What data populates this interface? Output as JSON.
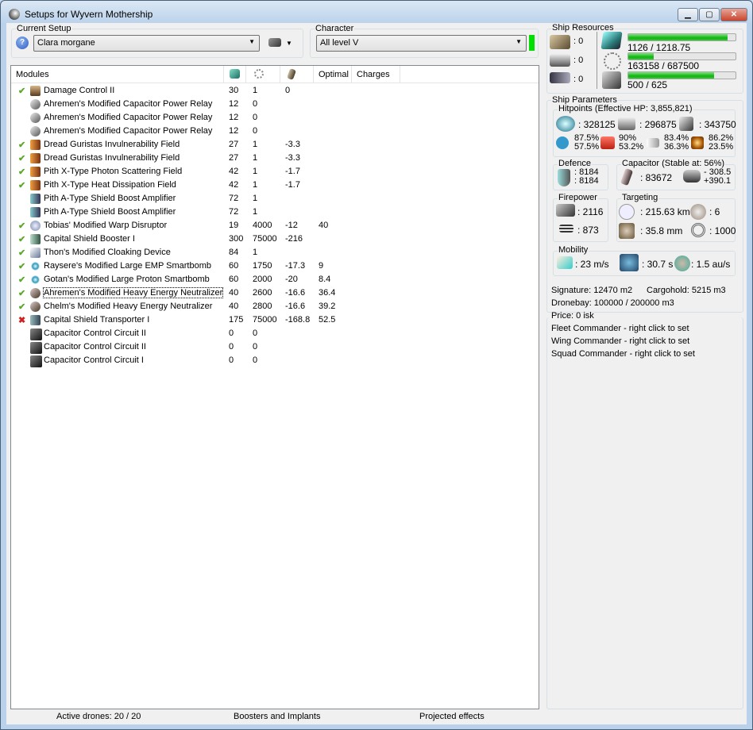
{
  "window": {
    "title": "Setups for Wyvern Mothership"
  },
  "setup": {
    "label": "Current Setup",
    "value": "Clara morgane"
  },
  "character": {
    "label": "Character",
    "value": "All level V",
    "status_color": "#00e000"
  },
  "modules": {
    "headers": [
      "Modules",
      "cpu-icon",
      "powergrid-icon",
      "capacitor-icon",
      "Optimal",
      "Charges"
    ],
    "rows": [
      {
        "state": "on",
        "icon": "damage-control",
        "name": "Damage Control II",
        "c1": "30",
        "c2": "1",
        "c3": "0",
        "c4": ""
      },
      {
        "state": "",
        "icon": "power-relay",
        "name": "Ahremen's Modified Capacitor Power Relay",
        "c1": "12",
        "c2": "0",
        "c3": "",
        "c4": ""
      },
      {
        "state": "",
        "icon": "power-relay",
        "name": "Ahremen's Modified Capacitor Power Relay",
        "c1": "12",
        "c2": "0",
        "c3": "",
        "c4": ""
      },
      {
        "state": "",
        "icon": "power-relay",
        "name": "Ahremen's Modified Capacitor Power Relay",
        "c1": "12",
        "c2": "0",
        "c3": "",
        "c4": ""
      },
      {
        "state": "on",
        "icon": "shield-hardener",
        "name": "Dread Guristas Invulnerability Field",
        "c1": "27",
        "c2": "1",
        "c3": "-3.3",
        "c4": ""
      },
      {
        "state": "on",
        "icon": "shield-hardener",
        "name": "Dread Guristas Invulnerability Field",
        "c1": "27",
        "c2": "1",
        "c3": "-3.3",
        "c4": ""
      },
      {
        "state": "on",
        "icon": "shield-hardener",
        "name": "Pith X-Type Photon Scattering Field",
        "c1": "42",
        "c2": "1",
        "c3": "-1.7",
        "c4": ""
      },
      {
        "state": "on",
        "icon": "shield-hardener",
        "name": "Pith X-Type Heat Dissipation Field",
        "c1": "42",
        "c2": "1",
        "c3": "-1.7",
        "c4": ""
      },
      {
        "state": "",
        "icon": "shield-amp",
        "name": "Pith A-Type Shield Boost Amplifier",
        "c1": "72",
        "c2": "1",
        "c3": "",
        "c4": ""
      },
      {
        "state": "",
        "icon": "shield-amp",
        "name": "Pith A-Type Shield Boost Amplifier",
        "c1": "72",
        "c2": "1",
        "c3": "",
        "c4": ""
      },
      {
        "state": "on",
        "icon": "warp-disruptor",
        "name": "Tobias' Modified Warp Disruptor",
        "c1": "19",
        "c2": "4000",
        "c3": "-12",
        "c4": "40"
      },
      {
        "state": "on",
        "icon": "shield-booster",
        "name": "Capital Shield Booster I",
        "c1": "300",
        "c2": "75000",
        "c3": "-216",
        "c4": ""
      },
      {
        "state": "on",
        "icon": "cloak",
        "name": "Thon's Modified Cloaking Device",
        "c1": "84",
        "c2": "1",
        "c3": "",
        "c4": ""
      },
      {
        "state": "on",
        "icon": "smartbomb",
        "name": "Raysere's Modified Large EMP Smartbomb",
        "c1": "60",
        "c2": "1750",
        "c3": "-17.3",
        "c4": "9"
      },
      {
        "state": "on",
        "icon": "smartbomb",
        "name": "Gotan's Modified Large Proton Smartbomb",
        "c1": "60",
        "c2": "2000",
        "c3": "-20",
        "c4": "8.4"
      },
      {
        "state": "on",
        "icon": "neutralizer",
        "name": "Ahremen's Modified Heavy Energy Neutralizer",
        "c1": "40",
        "c2": "2600",
        "c3": "-16.6",
        "c4": "36.4",
        "focused": true
      },
      {
        "state": "on",
        "icon": "neutralizer",
        "name": "Chelm's Modified Heavy Energy Neutralizer",
        "c1": "40",
        "c2": "2800",
        "c3": "-16.6",
        "c4": "39.2"
      },
      {
        "state": "off",
        "icon": "shield-transporter",
        "name": "Capital Shield Transporter I",
        "c1": "175",
        "c2": "75000",
        "c3": "-168.8",
        "c4": "52.5"
      },
      {
        "state": "",
        "icon": "rig",
        "name": "Capacitor Control Circuit II",
        "c1": "0",
        "c2": "0",
        "c3": "",
        "c4": ""
      },
      {
        "state": "",
        "icon": "rig",
        "name": "Capacitor Control Circuit II",
        "c1": "0",
        "c2": "0",
        "c3": "",
        "c4": ""
      },
      {
        "state": "",
        "icon": "rig",
        "name": "Capacitor Control Circuit I",
        "c1": "0",
        "c2": "0",
        "c3": "",
        "c4": ""
      }
    ]
  },
  "status": {
    "drones": "Active drones: 20 / 20",
    "boosters": "Boosters and Implants",
    "projected": "Projected effects"
  },
  "resources": {
    "label": "Ship Resources",
    "turrets": ": 0",
    "launchers": ": 0",
    "rigs": ": 0",
    "cpu": {
      "text": "1126 / 1218.75",
      "fraction": 0.924
    },
    "power": {
      "text": "163158 / 687500",
      "fraction": 0.237
    },
    "calibration": {
      "text": "500 / 625",
      "fraction": 0.8
    }
  },
  "params": {
    "label": "Ship Parameters",
    "hp_label": "Hitpoints (Effective HP: 3,855,821)",
    "shield": ": 328125",
    "armor": ": 296875",
    "hull": ": 343750",
    "res": [
      [
        "87.5%",
        "57.5%"
      ],
      [
        "90%",
        "53.2%"
      ],
      [
        "83.4%",
        "36.3%"
      ],
      [
        "86.2%",
        "23.5%"
      ]
    ],
    "defence": {
      "label": "Defence",
      "a": ": 8184",
      "b": ": 8184"
    },
    "capacitor": {
      "label": "Capacitor (Stable at: 56%)",
      "amount": ": 83672",
      "minus": "- 308.5",
      "plus": "+390.1"
    },
    "firepower": {
      "label": "Firepower",
      "turret": ": 2116",
      "missile": ": 873"
    },
    "targeting": {
      "label": "Targeting",
      "range": ": 215.63 km",
      "targets": ": 6",
      "scan": ": 35.8 mm",
      "sensor": ": 1000"
    },
    "mobility": {
      "label": "Mobility",
      "speed": ": 23 m/s",
      "align": ": 30.7 s",
      "warp": ": 1.5 au/s"
    },
    "signature": "Signature: 12470 m2",
    "cargo": "Cargohold: 5215 m3",
    "dronebay": "Dronebay: 100000 / 200000 m3",
    "price": "Price: 0 isk",
    "fleet": "Fleet Commander - right click to set",
    "wing": "Wing Commander - right click to set",
    "squad": "Squad Commander - right click to set"
  }
}
